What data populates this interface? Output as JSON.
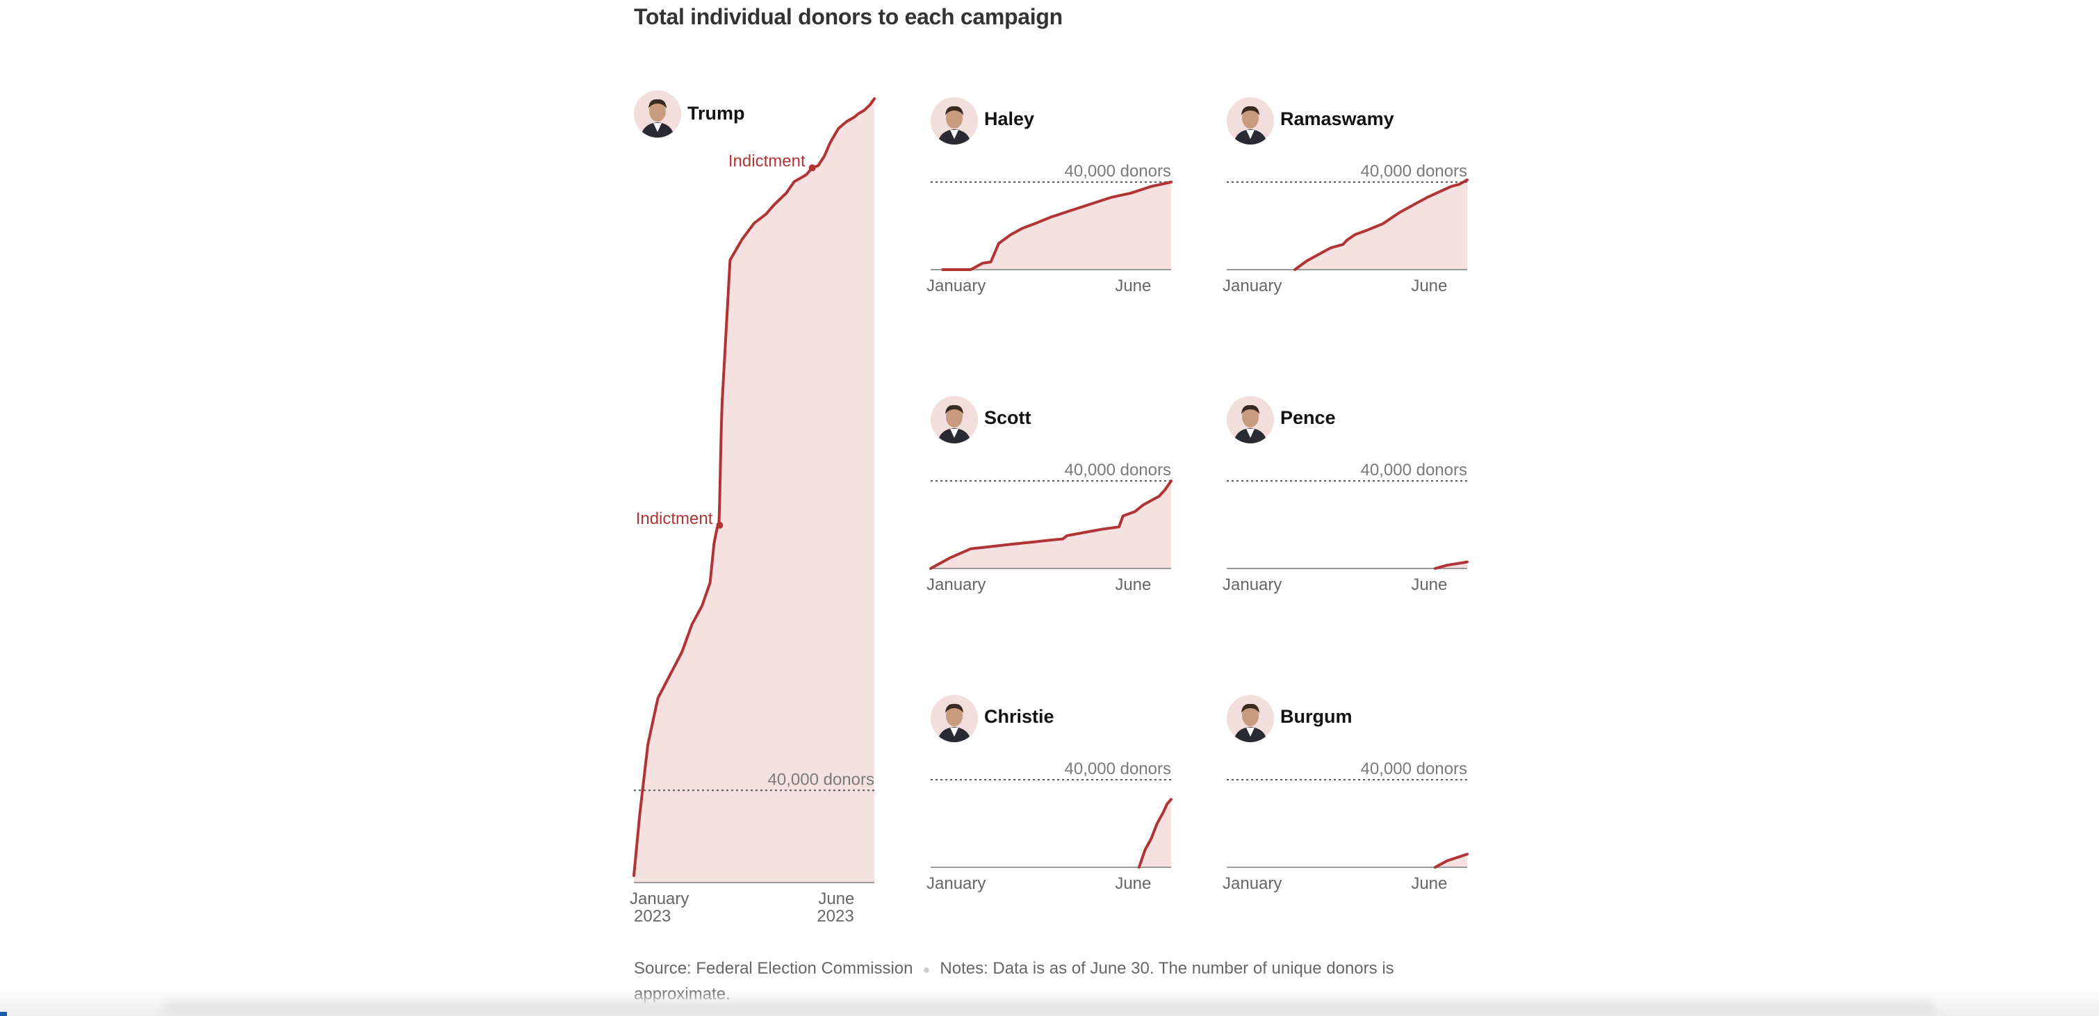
{
  "title": "Total individual donors to each campaign",
  "footer": {
    "source": "Source: Federal Election Commission",
    "notes": "Notes: Data is as of June 30. The number of unique donors is approximate."
  },
  "colors": {
    "line": "#b13434",
    "fill": "#f5e1e1",
    "threshold": "#555555",
    "axis": "#999999",
    "avatar_bg": "#f3dede"
  },
  "chart_data": [
    {
      "type": "area",
      "name": "Trump",
      "avatar_icon": "trump-portrait-icon",
      "x_unit": "month of 2023 (1 = Jan 1, 7 = Jul 1)",
      "xlim": [
        1,
        7
      ],
      "ylim": [
        0,
        340000
      ],
      "threshold": {
        "value": 40000,
        "label": "40,000 donors"
      },
      "xticks": [
        {
          "x": 1,
          "label": "January",
          "sublabel": "2023"
        },
        {
          "x": 6,
          "label": "June",
          "sublabel": "2023"
        }
      ],
      "x": [
        1.0,
        1.15,
        1.35,
        1.6,
        1.9,
        2.2,
        2.45,
        2.7,
        2.9,
        3.0,
        3.08,
        3.12,
        3.14,
        3.16,
        3.18,
        3.2,
        3.4,
        3.7,
        4.0,
        4.3,
        4.5,
        4.8,
        5.0,
        5.3,
        5.45,
        5.6,
        5.75,
        5.9,
        6.1,
        6.3,
        6.4,
        6.5,
        6.6,
        6.75,
        6.9,
        7.0
      ],
      "y": [
        3000,
        30000,
        60000,
        80000,
        90000,
        100000,
        112000,
        120000,
        130000,
        147000,
        154000,
        155000,
        165000,
        182000,
        196000,
        208000,
        270000,
        279000,
        286000,
        290000,
        294000,
        299000,
        304000,
        307000,
        310000,
        311000,
        315000,
        321000,
        327000,
        330000,
        331000,
        332000,
        333500,
        335000,
        337500,
        340000
      ],
      "annotations": [
        {
          "label": "Indictment",
          "x": 3.14,
          "y": 155000
        },
        {
          "label": "Indictment",
          "x": 5.45,
          "y": 310000
        }
      ]
    },
    {
      "type": "area",
      "name": "Haley",
      "avatar_icon": "haley-portrait-icon",
      "x_unit": "month of 2023 (1 = Jan 1, 7 = Jul 1)",
      "xlim": [
        1,
        7
      ],
      "ylim": [
        0,
        40000
      ],
      "threshold": {
        "value": 40000,
        "label": "40,000 donors"
      },
      "xticks": [
        {
          "x": 1,
          "label": "January"
        },
        {
          "x": 6,
          "label": "June"
        }
      ],
      "x": [
        1.3,
        2.0,
        2.3,
        2.5,
        2.7,
        3.0,
        3.3,
        3.6,
        4.0,
        4.5,
        5.0,
        5.5,
        6.0,
        6.5,
        7.0
      ],
      "y": [
        0,
        0,
        3000,
        3500,
        12000,
        16000,
        19000,
        21000,
        24000,
        27000,
        30000,
        33000,
        35000,
        38000,
        40000
      ]
    },
    {
      "type": "area",
      "name": "Ramaswamy",
      "avatar_icon": "ramaswamy-portrait-icon",
      "x_unit": "month of 2023 (1 = Jan 1, 7 = Jul 1)",
      "xlim": [
        1,
        7
      ],
      "ylim": [
        0,
        40000
      ],
      "threshold": {
        "value": 40000,
        "label": "40,000 donors"
      },
      "xticks": [
        {
          "x": 1,
          "label": "January"
        },
        {
          "x": 6,
          "label": "June"
        }
      ],
      "x": [
        2.7,
        3.0,
        3.3,
        3.6,
        3.9,
        4.0,
        4.2,
        4.5,
        4.9,
        5.3,
        5.7,
        6.0,
        6.3,
        6.6,
        6.8,
        7.0
      ],
      "y": [
        0,
        4000,
        7000,
        10000,
        11500,
        13500,
        16000,
        18000,
        21000,
        26000,
        30000,
        33000,
        35500,
        38000,
        39000,
        41000
      ]
    },
    {
      "type": "area",
      "name": "Scott",
      "avatar_icon": "scott-portrait-icon",
      "x_unit": "month of 2023 (1 = Jan 1, 7 = Jul 1)",
      "xlim": [
        1,
        7
      ],
      "ylim": [
        0,
        40000
      ],
      "threshold": {
        "value": 40000,
        "label": "40,000 donors"
      },
      "xticks": [
        {
          "x": 1,
          "label": "January"
        },
        {
          "x": 6,
          "label": "June"
        }
      ],
      "x": [
        1.0,
        1.5,
        2.0,
        2.5,
        3.0,
        3.5,
        4.0,
        4.3,
        4.4,
        4.7,
        5.0,
        5.3,
        5.7,
        5.8,
        6.1,
        6.3,
        6.5,
        6.7,
        6.85,
        7.0
      ],
      "y": [
        0,
        5000,
        9000,
        10000,
        11000,
        12000,
        13000,
        13500,
        15000,
        16000,
        17000,
        18000,
        19000,
        24000,
        26000,
        29000,
        31000,
        33000,
        36000,
        40000
      ]
    },
    {
      "type": "area",
      "name": "Pence",
      "avatar_icon": "pence-portrait-icon",
      "x_unit": "month of 2023 (1 = Jan 1, 7 = Jul 1)",
      "xlim": [
        1,
        7
      ],
      "ylim": [
        0,
        40000
      ],
      "threshold": {
        "value": 40000,
        "label": "40,000 donors"
      },
      "xticks": [
        {
          "x": 1,
          "label": "January"
        },
        {
          "x": 6,
          "label": "June"
        }
      ],
      "x": [
        6.2,
        6.5,
        7.0
      ],
      "y": [
        0,
        1500,
        3000
      ]
    },
    {
      "type": "area",
      "name": "Christie",
      "avatar_icon": "christie-portrait-icon",
      "x_unit": "month of 2023 (1 = Jan 1, 7 = Jul 1)",
      "xlim": [
        1,
        7
      ],
      "ylim": [
        0,
        40000
      ],
      "threshold": {
        "value": 40000,
        "label": "40,000 donors"
      },
      "xticks": [
        {
          "x": 1,
          "label": "January"
        },
        {
          "x": 6,
          "label": "June"
        }
      ],
      "x": [
        6.2,
        6.35,
        6.5,
        6.65,
        6.8,
        6.9,
        7.0
      ],
      "y": [
        0,
        8000,
        13000,
        20000,
        25000,
        29000,
        31000
      ]
    },
    {
      "type": "area",
      "name": "Burgum",
      "avatar_icon": "burgum-portrait-icon",
      "x_unit": "month of 2023 (1 = Jan 1, 7 = Jul 1)",
      "xlim": [
        1,
        7
      ],
      "ylim": [
        0,
        40000
      ],
      "threshold": {
        "value": 40000,
        "label": "40,000 donors"
      },
      "xticks": [
        {
          "x": 1,
          "label": "January"
        },
        {
          "x": 6,
          "label": "June"
        }
      ],
      "x": [
        6.2,
        6.5,
        7.0
      ],
      "y": [
        0,
        3000,
        6000
      ]
    }
  ]
}
